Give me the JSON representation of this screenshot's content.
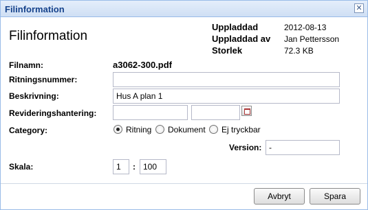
{
  "window": {
    "title": "Filinformation",
    "close_symbol": "✕"
  },
  "header": {
    "title": "Filinformation",
    "meta": {
      "uploaded_label": "Uppladdad",
      "uploaded_value": "2012-08-13",
      "uploaded_by_label": "Uppladdad av",
      "uploaded_by_value": "Jan Pettersson",
      "size_label": "Storlek",
      "size_value": "72.3 KB"
    }
  },
  "form": {
    "filename_label": "Filnamn:",
    "filename_value": "a3062-300.pdf",
    "drawing_number_label": "Ritningsnummer:",
    "drawing_number_value": "",
    "description_label": "Beskrivning:",
    "description_value": "Hus A plan 1",
    "revision_label": "Revideringshantering:",
    "revision_value_1": "",
    "revision_value_2": "",
    "category_label": "Category:",
    "category_options": [
      "Ritning",
      "Dokument",
      "Ej tryckbar"
    ],
    "category_selected": "Ritning",
    "version_label": "Version:",
    "version_value": "-",
    "scale_label": "Skala:",
    "scale_left": "1",
    "scale_separator": ":",
    "scale_right": "100"
  },
  "footer": {
    "cancel_label": "Avbryt",
    "save_label": "Spara"
  },
  "icons": {
    "close": "close-icon",
    "date_picker": "calendar-icon"
  },
  "colors": {
    "titlebar_text": "#15428b",
    "border": "#99bbe8"
  }
}
